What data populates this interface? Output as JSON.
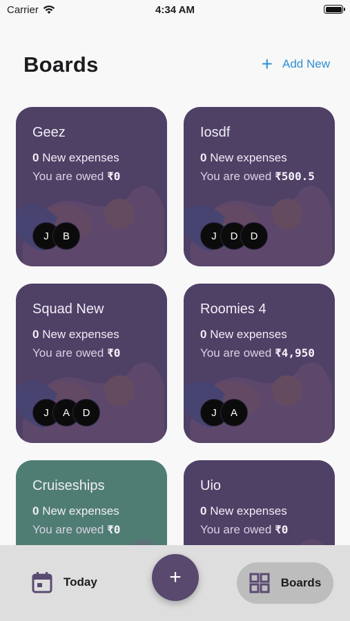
{
  "status_bar": {
    "carrier": "Carrier",
    "time": "4:34 AM"
  },
  "header": {
    "title": "Boards",
    "add_new_label": "Add New",
    "add_icon": "plus-icon"
  },
  "boards": [
    {
      "name": "Geez",
      "new_count": "0",
      "new_label": "New expenses",
      "owed_label": "You are owed",
      "owed_amount": "₹0",
      "members": [
        "J",
        "B"
      ],
      "color": "#4f4066"
    },
    {
      "name": "Iosdf",
      "new_count": "0",
      "new_label": "New expenses",
      "owed_label": "You are owed",
      "owed_amount": "₹500.5",
      "members": [
        "J",
        "D",
        "D"
      ],
      "color": "#4f4066"
    },
    {
      "name": "Squad New",
      "new_count": "0",
      "new_label": "New expenses",
      "owed_label": "You are owed",
      "owed_amount": "₹0",
      "members": [
        "J",
        "A",
        "D"
      ],
      "color": "#4f4066"
    },
    {
      "name": "Roomies 4",
      "new_count": "0",
      "new_label": "New expenses",
      "owed_label": "You are owed",
      "owed_amount": "₹4,950",
      "members": [
        "J",
        "A"
      ],
      "color": "#4f4066"
    },
    {
      "name": "Cruiseships",
      "new_count": "0",
      "new_label": "New expenses",
      "owed_label": "You are owed",
      "owed_amount": "₹0",
      "members": [],
      "color": "#4f7d73"
    },
    {
      "name": "Uio",
      "new_count": "0",
      "new_label": "New expenses",
      "owed_label": "You are owed",
      "owed_amount": "₹0",
      "members": [],
      "color": "#4f4066"
    }
  ],
  "tabbar": {
    "today_label": "Today",
    "today_icon": "calendar-icon",
    "fab_icon": "plus-icon",
    "boards_label": "Boards",
    "boards_icon": "grid-icon"
  }
}
